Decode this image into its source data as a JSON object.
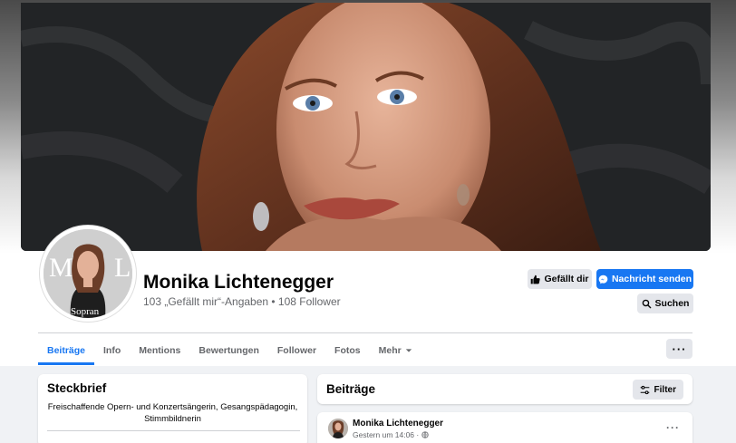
{
  "profile": {
    "name": "Monika Lichtenegger",
    "stats": "103 „Gefällt mir“-Angaben • 108 Follower",
    "picture_overlay_text": "Sopran"
  },
  "actions": {
    "like_label": "Gefällt dir",
    "message_label": "Nachricht senden",
    "search_label": "Suchen"
  },
  "tabs": [
    {
      "label": "Beiträge",
      "active": true
    },
    {
      "label": "Info"
    },
    {
      "label": "Mentions"
    },
    {
      "label": "Bewertungen"
    },
    {
      "label": "Follower"
    },
    {
      "label": "Fotos"
    },
    {
      "label": "Mehr"
    }
  ],
  "more_menu": "···",
  "steckbrief": {
    "title": "Steckbrief",
    "text": "Freischaffende Opern- und Konzertsängerin, Gesangspädagogin, Stimmbildnerin"
  },
  "feed": {
    "title": "Beiträge",
    "filter_label": "Filter"
  },
  "post": {
    "author": "Monika Lichtenegger",
    "time": "Gestern um 14:06 ·",
    "more": "···"
  },
  "colors": {
    "accent": "#1877f2",
    "button_gray": "#e4e6eb",
    "secondary_text": "#65676b",
    "page_bg": "#f0f2f5"
  }
}
